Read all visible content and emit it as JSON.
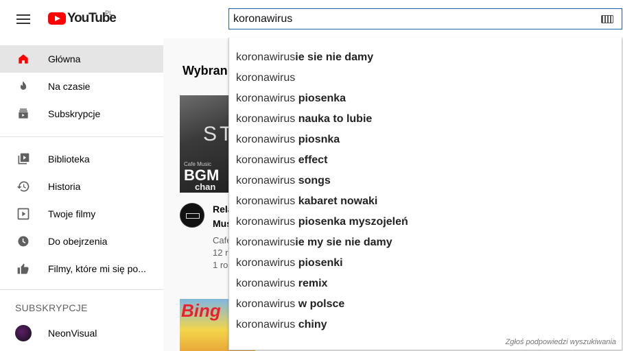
{
  "header": {
    "logo_text": "YouTube",
    "region": "PL",
    "search_value": "koronawirus"
  },
  "sidebar": {
    "items": [
      {
        "label": "Główna",
        "icon": "home-icon",
        "active": true
      },
      {
        "label": "Na czasie",
        "icon": "trending-icon"
      },
      {
        "label": "Subskrypcje",
        "icon": "subscriptions-icon"
      },
      {
        "label": "Biblioteka",
        "icon": "library-icon"
      },
      {
        "label": "Historia",
        "icon": "history-icon"
      },
      {
        "label": "Twoje filmy",
        "icon": "your-videos-icon"
      },
      {
        "label": "Do obejrzenia",
        "icon": "watch-later-icon"
      },
      {
        "label": "Filmy, które mi się po...",
        "icon": "liked-icon"
      }
    ],
    "subscriptions_header": "SUBSKRYPCJE",
    "subscriptions": [
      {
        "label": "NeonVisual"
      }
    ]
  },
  "main": {
    "section_title": "Wybran",
    "video1": {
      "thumb_st": "ST",
      "thumb_cafe": "Cafe Music",
      "thumb_bgm": "BGM",
      "thumb_chan": "chan",
      "title_line1": "Rela",
      "title_line2": "Mus",
      "channel": "Cafe",
      "views": "12 r",
      "age": "1 ro"
    },
    "video2": {
      "thumb_text": "Bing"
    }
  },
  "suggestions": {
    "items": [
      {
        "query": "koronawirus",
        "rest": "ie sie nie damy"
      },
      {
        "query": "koronawirus",
        "rest": ""
      },
      {
        "query": "koronawirus",
        "rest": " piosenka"
      },
      {
        "query": "koronawirus",
        "rest": " nauka to lubie"
      },
      {
        "query": "koronawirus",
        "rest": " piosnka"
      },
      {
        "query": "koronawirus",
        "rest": " effect"
      },
      {
        "query": "koronawirus",
        "rest": " songs"
      },
      {
        "query": "koronawirus",
        "rest": " kabaret nowaki"
      },
      {
        "query": "koronawirus",
        "rest": " piosenka myszojeleń"
      },
      {
        "query": "koronawirus",
        "rest": "ie my sie nie damy"
      },
      {
        "query": "koronawirus",
        "rest": " piosenki"
      },
      {
        "query": "koronawirus",
        "rest": " remix"
      },
      {
        "query": "koronawirus",
        "rest": " w polsce"
      },
      {
        "query": "koronawirus",
        "rest": " chiny"
      }
    ],
    "report_label": "Zgłoś podpowiedzi wyszukiwania"
  },
  "colors": {
    "brand": "#ff0000",
    "search_focus": "#1c62b9"
  }
}
